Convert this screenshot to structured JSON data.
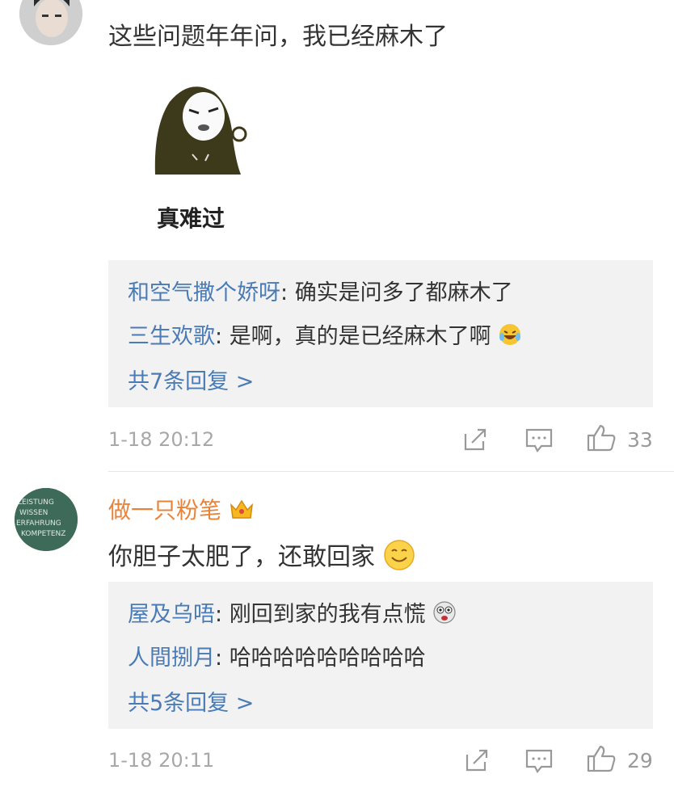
{
  "comments": [
    {
      "text": "这些问题年年问，我已经麻木了",
      "sticker_caption": "真难过",
      "replies": [
        {
          "name": "和空气撒个娇呀",
          "sep": ": ",
          "text": "确实是问多了都麻木了"
        },
        {
          "name": "三生欢歌",
          "sep": ": ",
          "text": "是啊，真的是已经麻木了啊"
        }
      ],
      "more_replies": "共7条回复 >",
      "time": "1-18 20:12",
      "likes": "33"
    },
    {
      "author": "做一只粉笔",
      "avatar_text": [
        "LEISTUNG",
        "WISSEN",
        "ERFAHRUNG",
        "KOMPETENZ"
      ],
      "text": "你胆子太肥了，还敢回家",
      "replies": [
        {
          "name": "屋及乌唔",
          "sep": ": ",
          "text": "刚回到家的我有点慌"
        },
        {
          "name": "人間捌月",
          "sep": ": ",
          "text": "哈哈哈哈哈哈哈哈哈"
        }
      ],
      "more_replies": "共5条回复 >",
      "time": "1-18 20:11",
      "likes": "29"
    }
  ],
  "icons": [
    "share-icon",
    "comment-icon",
    "like-icon",
    "crown-badge-icon",
    "smile-emoji-icon",
    "laugh-cry-emoji-icon",
    "scared-emoji-icon"
  ],
  "colors": {
    "author": "#e8843a",
    "reply_name": "#4a7bb5",
    "reply_bg": "#f2f2f2",
    "meta": "#a8a8a8"
  }
}
